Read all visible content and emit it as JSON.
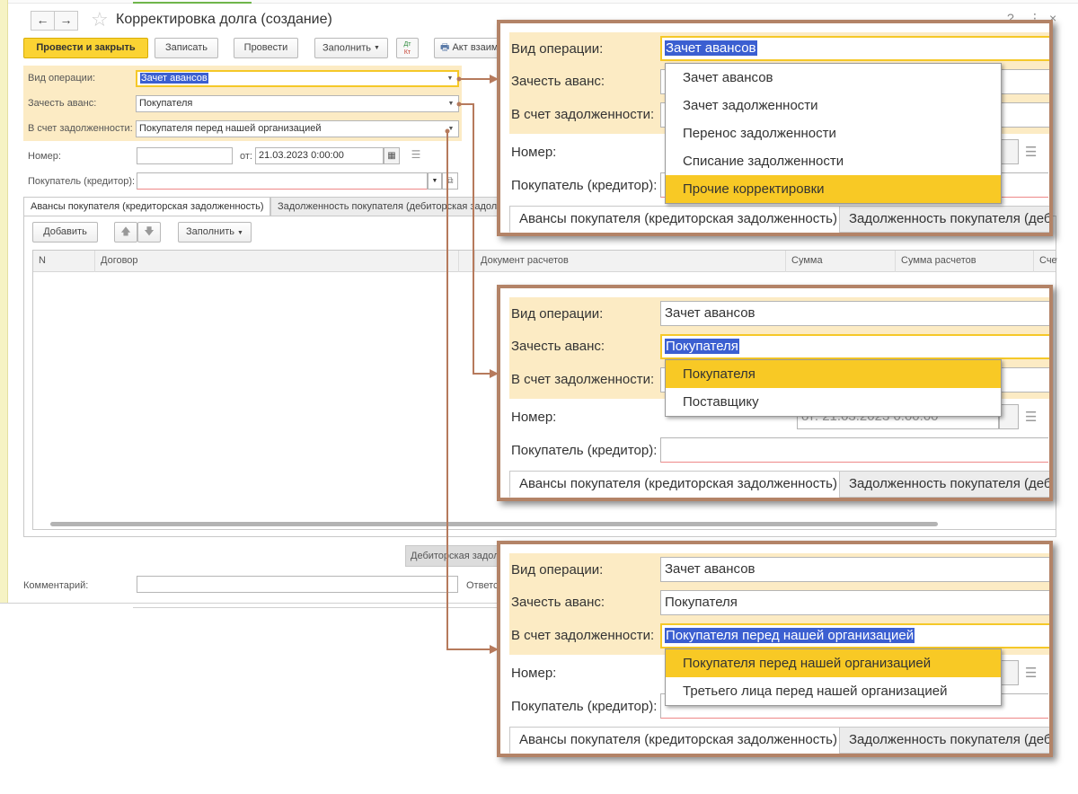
{
  "window": {
    "title": "Корректировка долга (создание)",
    "nav_back": "←",
    "nav_forward": "→",
    "help": "?",
    "more": "⋮",
    "close": "×"
  },
  "toolbar": {
    "post_and_close": "Провести и закрыть",
    "save": "Записать",
    "post": "Провести",
    "fill": "Заполнить",
    "dtkt_top": "Дт",
    "dtkt_bottom": "Кт",
    "print": "Акт взаиморасчетов"
  },
  "form": {
    "operation_label": "Вид операции:",
    "operation_value": "Зачет авансов",
    "advance_label": "Зачесть аванс:",
    "advance_value": "Покупателя",
    "debt_label": "В счет задолженности:",
    "debt_value": "Покупателя перед нашей организацией",
    "number_label": "Номер:",
    "number_value": "",
    "date_label": "от:",
    "date_value": "21.03.2023  0:00:00",
    "buyer_label": "Покупатель (кредитор):",
    "buyer_value": "",
    "comment_label": "Комментарий:",
    "comment_value": "",
    "responsible_label": "Ответственный:"
  },
  "tabs": [
    "Авансы покупателя (кредиторская задолженность)",
    "Задолженность покупателя (дебиторская задолженность)"
  ],
  "table_toolbar": {
    "add": "Добавить",
    "fill": "Заполнить"
  },
  "table_columns": [
    "N",
    "Договор",
    "Документ расчетов",
    "Сумма",
    "Сумма расчетов",
    "Счет"
  ],
  "bottom_tab": "Дебиторская задолженность",
  "callout1": {
    "operation_value": "Зачет авансов",
    "number_date": "",
    "options": [
      "Зачет авансов",
      "Зачет задолженности",
      "Перенос задолженности",
      "Списание задолженности",
      "Прочие корректировки"
    ],
    "selected": "Прочие корректировки"
  },
  "callout2": {
    "operation_value": "Зачет авансов",
    "advance_value": "Покупателя",
    "number_date": "от:  21.03.2023  0:00:00",
    "options": [
      "Покупателя",
      "Поставщику"
    ],
    "selected": "Покупателя"
  },
  "callout3": {
    "operation_value": "Зачет авансов",
    "advance_value": "Покупателя",
    "debt_value": "Покупателя перед нашей организацией",
    "options": [
      "Покупателя перед нашей организацией",
      "Третьего лица перед нашей организацией"
    ],
    "selected": "Покупателя перед нашей организацией"
  },
  "colors": {
    "accent_yellow": "#fbd333",
    "highlight_band": "#fcebc4",
    "callout_border": "#b38367",
    "selection_blue": "#3b5fd1"
  }
}
